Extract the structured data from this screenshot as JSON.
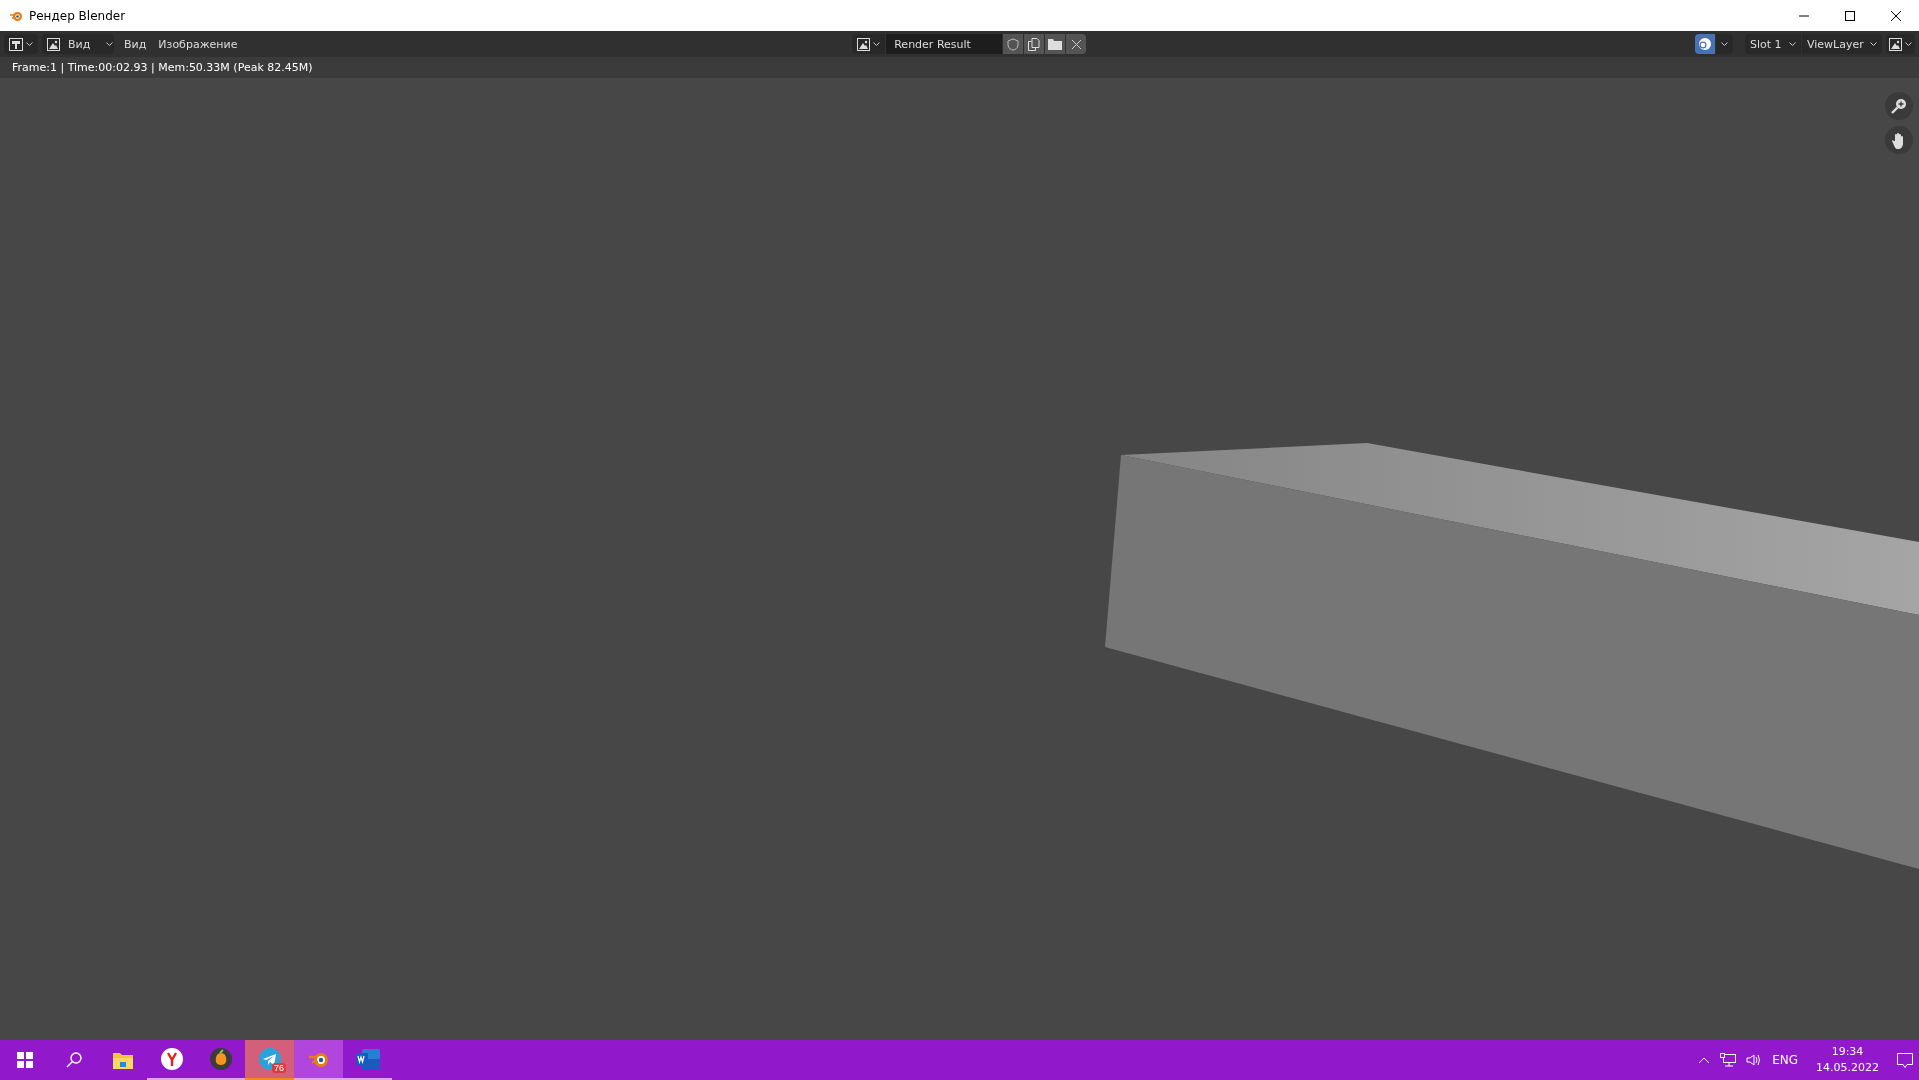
{
  "window": {
    "title": "Рендер Blender"
  },
  "header": {
    "view_mode": "Вид",
    "menus": [
      "Вид",
      "Изображение"
    ],
    "image_name": "Render Result",
    "slot": "Slot 1",
    "view_layer": "ViewLayer"
  },
  "info": {
    "text": "Frame:1 | Time:00:02.93 | Mem:50.33M (Peak 82.45M)"
  },
  "taskbar": {
    "apps": [
      {
        "kind": "explorer",
        "running": false,
        "selected": false,
        "attention": false
      },
      {
        "kind": "browser",
        "running": true,
        "selected": false,
        "attention": false
      },
      {
        "kind": "fruit",
        "running": true,
        "selected": false,
        "attention": false
      },
      {
        "kind": "messenger",
        "running": true,
        "selected": false,
        "attention": true,
        "badge": "76"
      },
      {
        "kind": "blender",
        "running": true,
        "selected": true,
        "attention": false
      },
      {
        "kind": "word",
        "running": true,
        "selected": false,
        "attention": false
      }
    ],
    "language": "ENG",
    "time": "19:34",
    "date": "14.05.2022"
  }
}
